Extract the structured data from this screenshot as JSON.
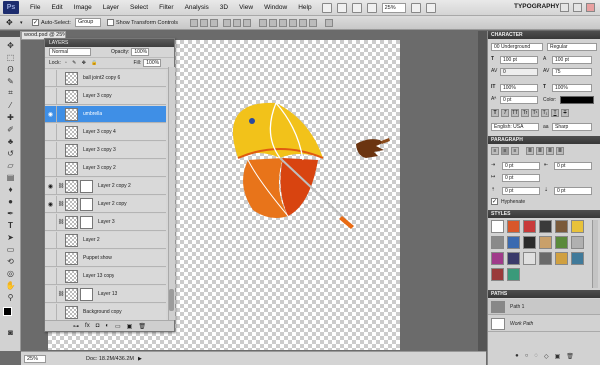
{
  "app": {
    "logo": "Ps",
    "workspace": "TYPOGRAPHY",
    "zoom": "25%"
  },
  "menu": [
    "File",
    "Edit",
    "Image",
    "Layer",
    "Select",
    "Filter",
    "Analysis",
    "3D",
    "View",
    "Window",
    "Help"
  ],
  "options_bar": {
    "auto_select_label": "Auto-Select:",
    "auto_select_value": "Group",
    "transform_label": "Show Transform Controls"
  },
  "document": {
    "tab": "wood.psd @ 25% (umbrella, RGB/8)",
    "status_zoom": "25%",
    "status_doc": "Doc: 18.2M/436.2M"
  },
  "layers_panel": {
    "title": "LAYERS",
    "blend_mode": "Normal",
    "opacity_label": "Opacity:",
    "opacity": "100%",
    "lock_label": "Lock:",
    "fill_label": "Fill:",
    "fill": "100%",
    "layers": [
      {
        "name": "ball joint2 copy 6",
        "visible": false,
        "selected": false,
        "mask": false
      },
      {
        "name": "Layer 3 copy",
        "visible": false,
        "selected": false,
        "mask": false
      },
      {
        "name": "umbrella",
        "visible": true,
        "selected": true,
        "mask": false
      },
      {
        "name": "Layer 3 copy 4",
        "visible": false,
        "selected": false,
        "mask": false
      },
      {
        "name": "Layer 3 copy 3",
        "visible": false,
        "selected": false,
        "mask": false
      },
      {
        "name": "Layer 3 copy 2",
        "visible": false,
        "selected": false,
        "mask": false
      },
      {
        "name": "Layer 2 copy 2",
        "visible": true,
        "selected": false,
        "mask": true
      },
      {
        "name": "Layer 2 copy",
        "visible": true,
        "selected": false,
        "mask": true
      },
      {
        "name": "Layer 3",
        "visible": false,
        "selected": false,
        "mask": true
      },
      {
        "name": "Layer 2",
        "visible": false,
        "selected": false,
        "mask": false
      },
      {
        "name": "Puppet show",
        "visible": false,
        "selected": false,
        "mask": false
      },
      {
        "name": "Layer 13 copy",
        "visible": false,
        "selected": false,
        "mask": false
      },
      {
        "name": "Layer 13",
        "visible": false,
        "selected": false,
        "mask": true
      },
      {
        "name": "Background copy",
        "visible": false,
        "selected": false,
        "mask": false
      }
    ]
  },
  "character_panel": {
    "title": "CHARACTER",
    "font_family": "00 Underground",
    "font_style": "Regular",
    "size": "100 pt",
    "leading": "100 pt",
    "kerning": "0",
    "tracking": "75",
    "vscale": "100%",
    "hscale": "100%",
    "baseline": "0 pt",
    "color_label": "Color:",
    "language": "English: USA",
    "antialias": "Sharp",
    "aa_label": "aa"
  },
  "paragraph_panel": {
    "title": "PARAGRAPH",
    "indent_left": "0 pt",
    "indent_right": "0 pt",
    "indent_first": "0 pt",
    "space_before": "0 pt",
    "space_after": "0 pt",
    "hyphenate_label": "Hyphenate"
  },
  "styles_panel": {
    "title": "STYLES"
  },
  "paths_panel": {
    "title": "PATHS",
    "paths": [
      "Path 1",
      "Work Path"
    ]
  }
}
